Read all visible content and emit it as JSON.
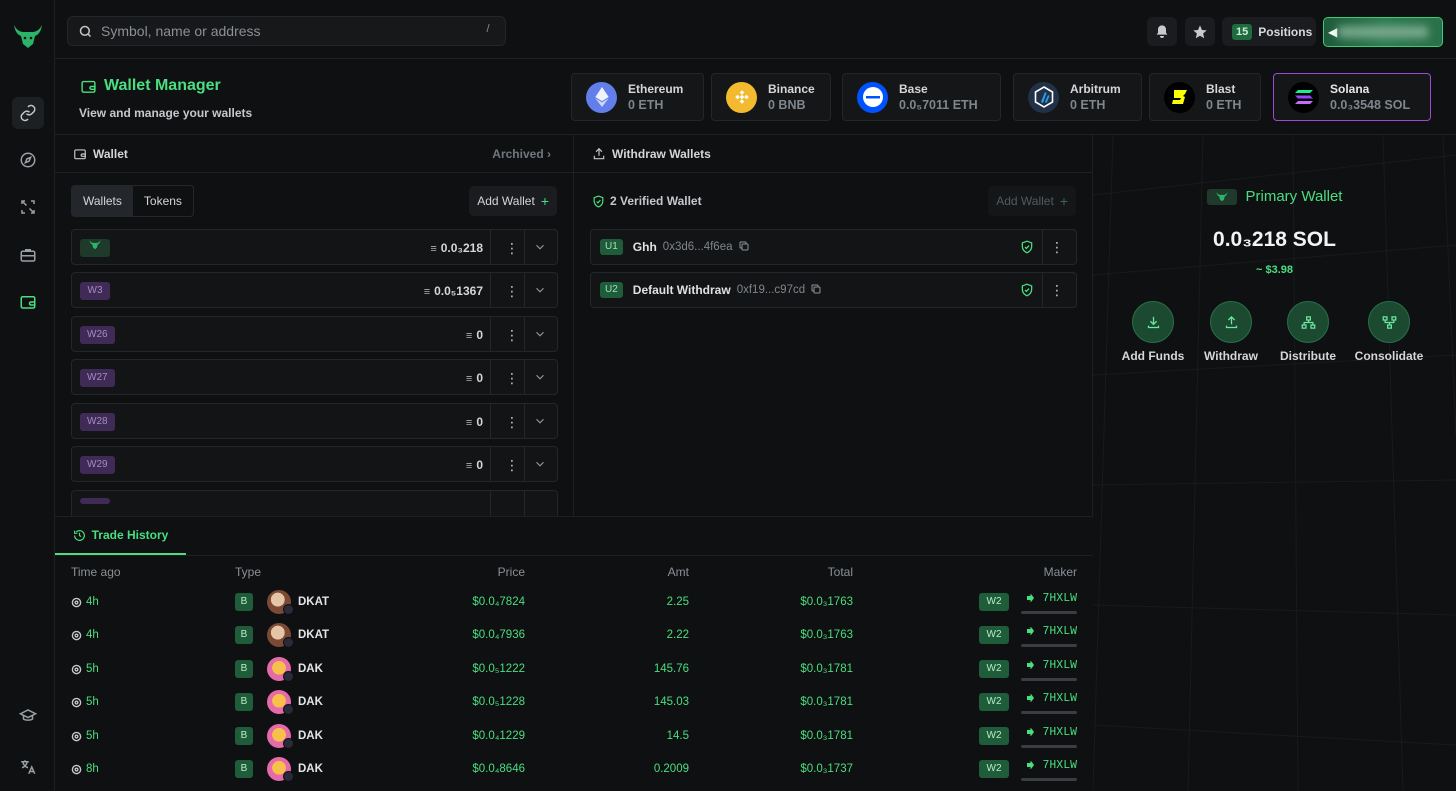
{
  "search": {
    "placeholder": "Symbol, name or address",
    "shortcut": "/"
  },
  "topbar": {
    "positions_count": "15",
    "positions_label": "Positions",
    "account_arrow": "◀"
  },
  "header": {
    "title": "Wallet Manager",
    "subtitle": "View and manage your wallets"
  },
  "chains": [
    {
      "name": "Ethereum",
      "value": "0 ETH",
      "color": "#627eea"
    },
    {
      "name": "Binance",
      "value": "0 BNB",
      "color": "#f3ba2f"
    },
    {
      "name": "Base",
      "value": "0.0₅7011 ETH",
      "color": "#0052ff"
    },
    {
      "name": "Arbitrum",
      "value": "0 ETH",
      "color": "#213147"
    },
    {
      "name": "Blast",
      "value": "0 ETH",
      "color": "#fcfc03"
    },
    {
      "name": "Solana",
      "value": "0.0₃3548 SOL",
      "color": "#9945ff"
    }
  ],
  "wallet_panel": {
    "title": "Wallet",
    "archived": "Archived",
    "tabs": [
      "Wallets",
      "Tokens"
    ],
    "add_wallet": "Add Wallet",
    "rows": [
      {
        "badge": "",
        "balance": "0.0₃218"
      },
      {
        "badge": "W3",
        "balance": "0.0₅1367"
      },
      {
        "badge": "W26",
        "balance": "0"
      },
      {
        "badge": "W27",
        "balance": "0"
      },
      {
        "badge": "W28",
        "balance": "0"
      },
      {
        "badge": "W29",
        "balance": "0"
      }
    ]
  },
  "withdraw_panel": {
    "title": "Withdraw Wallets",
    "verified": "2 Verified Wallet",
    "add_wallet": "Add Wallet",
    "rows": [
      {
        "badge": "U1",
        "name": "Ghh",
        "address": "0x3d6...4f6ea"
      },
      {
        "badge": "U2",
        "name": "Default Withdraw",
        "address": "0xf19...c97cd"
      }
    ]
  },
  "primary": {
    "title": "Primary Wallet",
    "balance": "0.0₃218 SOL",
    "usd": "~ $3.98",
    "actions": [
      "Add Funds",
      "Withdraw",
      "Distribute",
      "Consolidate"
    ]
  },
  "trade_history": {
    "tab": "Trade History",
    "columns": [
      "Time ago",
      "Type",
      "Price",
      "Amt",
      "Total",
      "Maker"
    ],
    "rows": [
      {
        "time": "4h",
        "type": "B",
        "token": "DKAT",
        "price": "$0.0₄7824",
        "amt": "2.25",
        "total": "$0.0₃1763",
        "wallet": "W2",
        "maker": "7HXLW"
      },
      {
        "time": "4h",
        "type": "B",
        "token": "DKAT",
        "price": "$0.0₄7936",
        "amt": "2.22",
        "total": "$0.0₃1763",
        "wallet": "W2",
        "maker": "7HXLW"
      },
      {
        "time": "5h",
        "type": "B",
        "token": "DAK",
        "price": "$0.0₅1222",
        "amt": "145.76",
        "total": "$0.0₃1781",
        "wallet": "W2",
        "maker": "7HXLW"
      },
      {
        "time": "5h",
        "type": "B",
        "token": "DAK",
        "price": "$0.0₅1228",
        "amt": "145.03",
        "total": "$0.0₃1781",
        "wallet": "W2",
        "maker": "7HXLW"
      },
      {
        "time": "5h",
        "type": "B",
        "token": "DAK",
        "price": "$0.0₄1229",
        "amt": "14.5",
        "total": "$0.0₃1781",
        "wallet": "W2",
        "maker": "7HXLW"
      },
      {
        "time": "8h",
        "type": "B",
        "token": "DAK",
        "price": "$0.0₄8646",
        "amt": "0.2009",
        "total": "$0.0₃1737",
        "wallet": "W2",
        "maker": "7HXLW"
      }
    ]
  }
}
